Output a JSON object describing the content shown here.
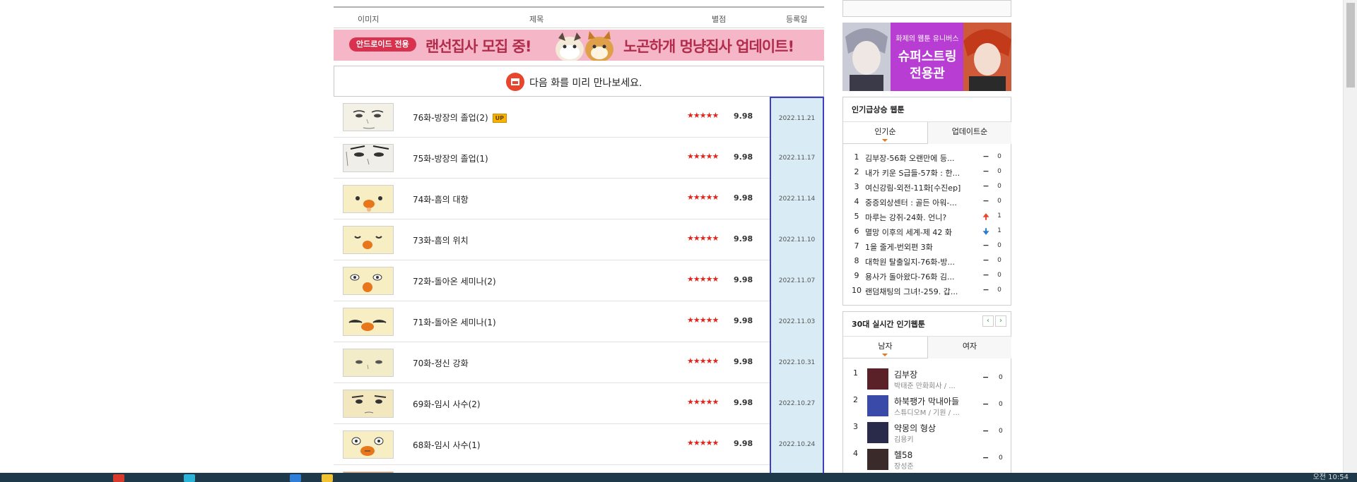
{
  "header": {
    "col_image": "이미지",
    "col_title": "제목",
    "col_rating": "별점",
    "col_date": "등록일"
  },
  "banner": {
    "pill": "안드로이드 전용",
    "text1": "랜선집사 모집 중!",
    "text2": "노곤하개 멍냥집사 업데이트!"
  },
  "preview": {
    "text": "다음 화를 미리 만나보세요."
  },
  "episodes": [
    {
      "title": "76화-방장의 졸업(2)",
      "badge": "UP",
      "stars": "★★★★★",
      "score": "9.98",
      "date": "2022.11.21"
    },
    {
      "title": "75화-방장의 졸업(1)",
      "stars": "★★★★★",
      "score": "9.98",
      "date": "2022.11.17"
    },
    {
      "title": "74화-흠의 대항",
      "stars": "★★★★★",
      "score": "9.98",
      "date": "2022.11.14"
    },
    {
      "title": "73화-흠의 위치",
      "stars": "★★★★★",
      "score": "9.98",
      "date": "2022.11.10"
    },
    {
      "title": "72화-돌아온 세미나(2)",
      "stars": "★★★★★",
      "score": "9.98",
      "date": "2022.11.07"
    },
    {
      "title": "71화-돌아온 세미나(1)",
      "stars": "★★★★★",
      "score": "9.98",
      "date": "2022.11.03"
    },
    {
      "title": "70화-정신 강화",
      "stars": "★★★★★",
      "score": "9.98",
      "date": "2022.10.31"
    },
    {
      "title": "69화-임시 사수(2)",
      "stars": "★★★★★",
      "score": "9.98",
      "date": "2022.10.27"
    },
    {
      "title": "68화-임시 사수(1)",
      "stars": "★★★★★",
      "score": "9.98",
      "date": "2022.10.24"
    }
  ],
  "ad": {
    "line1": "화제의 웹툰 유니버스",
    "line2": "슈퍼스트링",
    "line3": "전용관"
  },
  "rising": {
    "title": "인기급상승 웹툰",
    "tab_left": "인기순",
    "tab_right": "업데이트순",
    "items": [
      {
        "n": "1",
        "title": "김부장-56화 오랜만에 등...",
        "chg": "−",
        "cnt": "0",
        "dir": "same"
      },
      {
        "n": "2",
        "title": "내가 키운 S급들-57화 : 한...",
        "chg": "−",
        "cnt": "0",
        "dir": "same"
      },
      {
        "n": "3",
        "title": "여신강림-외전-11화[수진ep]",
        "chg": "−",
        "cnt": "0",
        "dir": "same"
      },
      {
        "n": "4",
        "title": "중증외상센터 : 골든 아워-...",
        "chg": "−",
        "cnt": "0",
        "dir": "same"
      },
      {
        "n": "5",
        "title": "마루는 강쥐-24화. 언니?",
        "chg": "🠉",
        "cnt": "1",
        "dir": "up"
      },
      {
        "n": "6",
        "title": "멸망 이후의 세계-제 42 화",
        "chg": "🠋",
        "cnt": "1",
        "dir": "down"
      },
      {
        "n": "7",
        "title": "1을 줄게-번외편 3화",
        "chg": "−",
        "cnt": "0",
        "dir": "same"
      },
      {
        "n": "8",
        "title": "대학원 탈출일지-76화-방...",
        "chg": "−",
        "cnt": "0",
        "dir": "same"
      },
      {
        "n": "9",
        "title": "용사가 돌아왔다-76화 김...",
        "chg": "−",
        "cnt": "0",
        "dir": "same"
      },
      {
        "n": "10",
        "title": "랜덤채팅의 그녀!-259. 갑...",
        "chg": "−",
        "cnt": "0",
        "dir": "same"
      }
    ]
  },
  "realtime": {
    "title": "30대 실시간 인기웹툰",
    "prev": "‹",
    "next": "›",
    "tab_left": "남자",
    "tab_right": "여자",
    "items": [
      {
        "n": "1",
        "title": "김부장",
        "author": "박태준 만화회사 / ...",
        "chg": "−",
        "cnt": "0"
      },
      {
        "n": "2",
        "title": "하북팽가 막내아들",
        "author": "스튜디오M / 기원 / ...",
        "chg": "−",
        "cnt": "0"
      },
      {
        "n": "3",
        "title": "약몽의 형상",
        "author": "김용키",
        "chg": "−",
        "cnt": "0"
      },
      {
        "n": "4",
        "title": "헬58",
        "author": "장성준",
        "chg": "−",
        "cnt": "0"
      }
    ]
  },
  "taskbar": {
    "clock": "오전 10:54"
  }
}
